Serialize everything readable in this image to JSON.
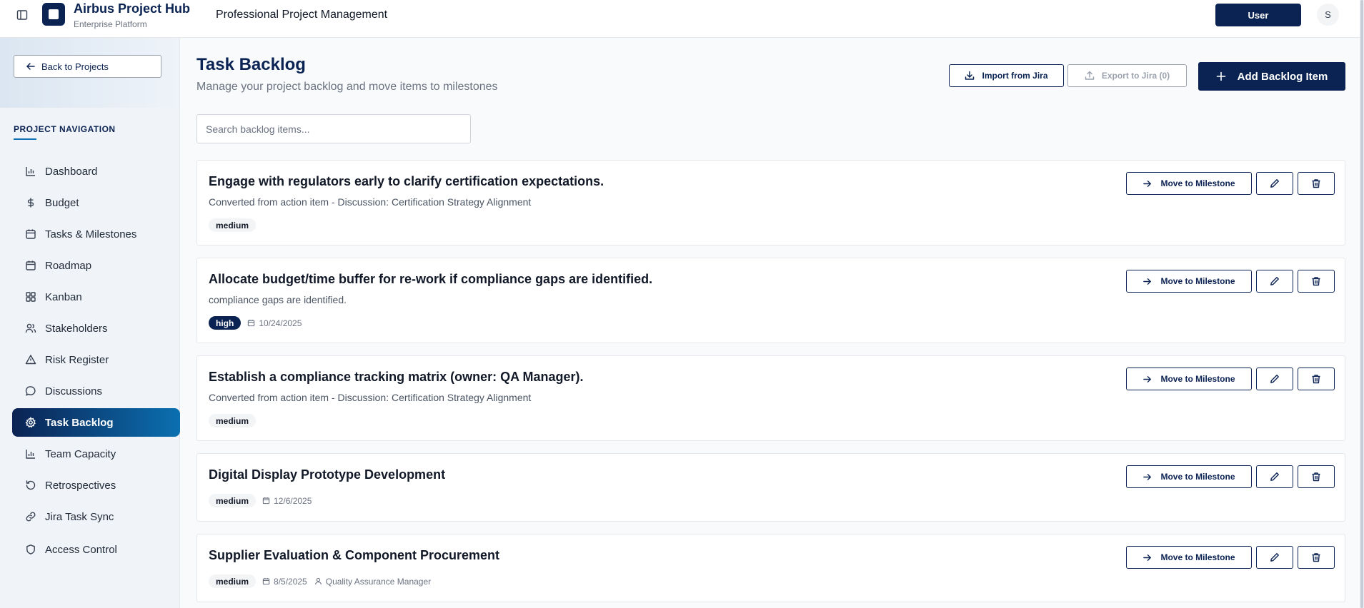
{
  "header": {
    "brand_title": "Airbus Project Hub",
    "brand_subtitle": "Enterprise Platform",
    "app_title": "Professional Project Management",
    "user_label": "User",
    "avatar_initial": "S"
  },
  "sidebar": {
    "back_label": "Back to Projects",
    "nav_heading": "PROJECT NAVIGATION",
    "items": [
      {
        "label": "Dashboard",
        "icon": "bar-chart-icon"
      },
      {
        "label": "Budget",
        "icon": "dollar-icon"
      },
      {
        "label": "Tasks & Milestones",
        "icon": "calendar-icon"
      },
      {
        "label": "Roadmap",
        "icon": "calendar-icon"
      },
      {
        "label": "Kanban",
        "icon": "grid-icon"
      },
      {
        "label": "Stakeholders",
        "icon": "users-icon"
      },
      {
        "label": "Risk Register",
        "icon": "warning-icon"
      },
      {
        "label": "Discussions",
        "icon": "message-icon"
      },
      {
        "label": "Task Backlog",
        "icon": "gear-icon",
        "active": true
      },
      {
        "label": "Team Capacity",
        "icon": "bar-chart-icon"
      },
      {
        "label": "Retrospectives",
        "icon": "refresh-icon"
      },
      {
        "label": "Jira Task Sync",
        "icon": "link-icon"
      },
      {
        "label": "Access Control",
        "icon": "shield-icon"
      }
    ]
  },
  "main": {
    "title": "Task Backlog",
    "subtitle": "Manage your project backlog and move items to milestones",
    "import_label": "Import from Jira",
    "export_label": "Export to Jira (0)",
    "add_label": "Add Backlog Item",
    "search_placeholder": "Search backlog items...",
    "move_label": "Move to Milestone",
    "items": [
      {
        "title": "Engage with regulators early to clarify certification expectations.",
        "description": "Converted from action item - Discussion: Certification Strategy Alignment",
        "priority": "medium",
        "date": "",
        "owner": ""
      },
      {
        "title": "Allocate budget/time buffer for re-work if compliance gaps are identified.",
        "description": "compliance gaps are identified.",
        "priority": "high",
        "date": "10/24/2025",
        "owner": ""
      },
      {
        "title": "Establish a compliance tracking matrix (owner: QA Manager).",
        "description": "Converted from action item - Discussion: Certification Strategy Alignment",
        "priority": "medium",
        "date": "",
        "owner": ""
      },
      {
        "title": "Digital Display Prototype Development",
        "description": "",
        "priority": "medium",
        "date": "12/6/2025",
        "owner": ""
      },
      {
        "title": "Supplier Evaluation & Component Procurement",
        "description": "",
        "priority": "medium",
        "date": "8/5/2025",
        "owner": "Quality Assurance Manager"
      }
    ]
  },
  "colors": {
    "brand_navy": "#0b2353",
    "accent_blue": "#0b6fb0",
    "muted_text": "#6b7280",
    "badge_bg": "#f3f4f6"
  }
}
